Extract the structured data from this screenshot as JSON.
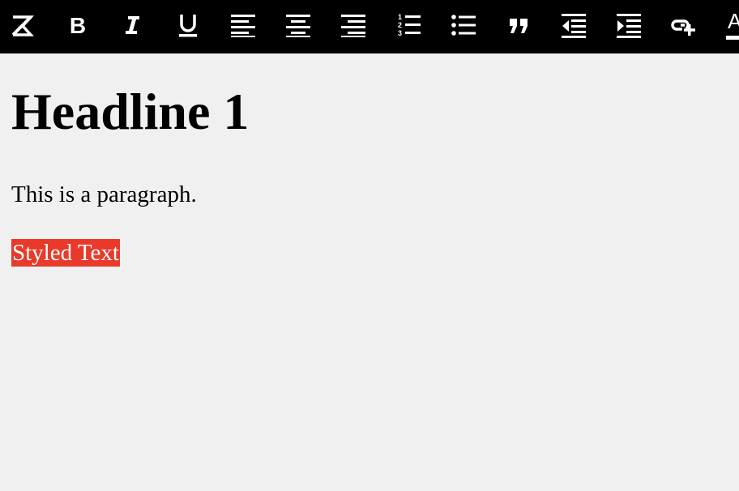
{
  "toolbar": {
    "background": "#000000",
    "icon_color": "#ffffff",
    "buttons": [
      {
        "name": "clear-format-icon"
      },
      {
        "name": "bold-icon",
        "glyph": "B"
      },
      {
        "name": "italic-icon"
      },
      {
        "name": "underline-icon"
      },
      {
        "name": "align-left-icon"
      },
      {
        "name": "align-center-icon"
      },
      {
        "name": "align-right-icon"
      },
      {
        "name": "ordered-list-icon",
        "numbers": [
          "1",
          "2",
          "3"
        ]
      },
      {
        "name": "unordered-list-icon"
      },
      {
        "name": "blockquote-icon"
      },
      {
        "name": "outdent-icon"
      },
      {
        "name": "indent-icon"
      },
      {
        "name": "insert-link-icon"
      },
      {
        "name": "text-color-icon",
        "glyph": "A"
      }
    ]
  },
  "editor": {
    "background": "#f0f0f0",
    "headline": "Headline 1",
    "paragraph": "This is a paragraph.",
    "styled_text": "Styled Text",
    "styled_text_background": "#e8392a",
    "styled_text_color": "#ffffff"
  }
}
